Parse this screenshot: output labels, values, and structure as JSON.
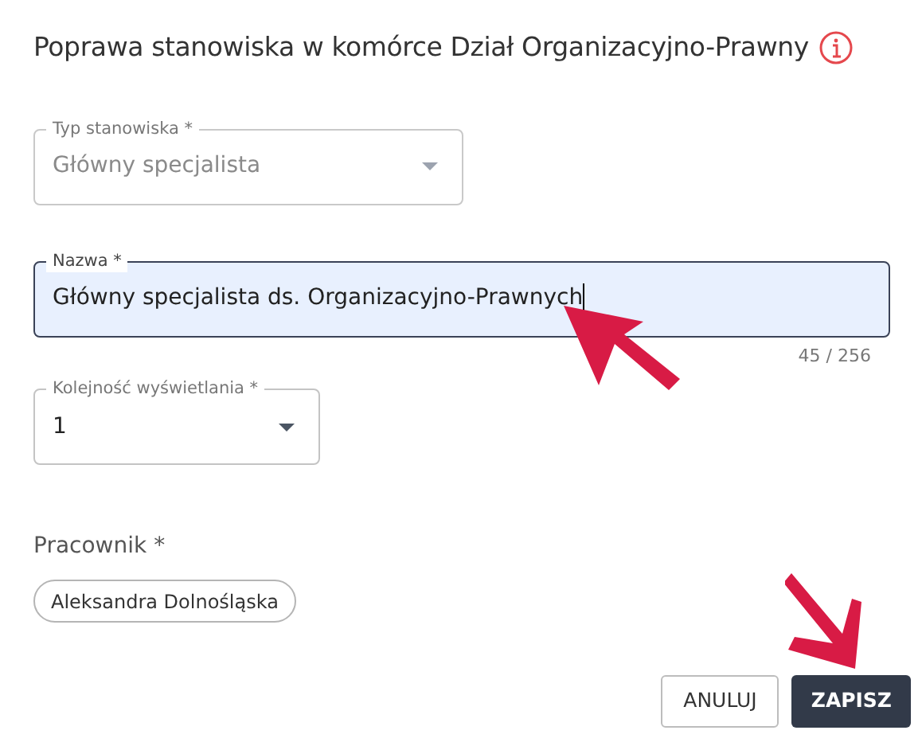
{
  "dialog": {
    "title": "Poprawa stanowiska w komórce Dział Organizacyjno-Prawny"
  },
  "fields": [
    {
      "kind": "select",
      "label": "Typ stanowiska *",
      "value": "Główny specjalista",
      "disabled": true,
      "focused": false
    },
    {
      "kind": "text",
      "label": "Nazwa *",
      "value": "Główny specjalista ds. Organizacyjno-Prawnych",
      "counter": "45 / 256",
      "disabled": false,
      "focused": true
    },
    {
      "kind": "select",
      "label": "Kolejność wyświetlania *",
      "value": "1",
      "disabled": false,
      "focused": false
    }
  ],
  "employee": {
    "label": "Pracownik *",
    "chips": [
      "Aleksandra Dolnośląska"
    ]
  },
  "buttons": [
    {
      "label": "ANULUJ",
      "kind": "outline"
    },
    {
      "label": "ZAPISZ",
      "kind": "primary"
    }
  ]
}
